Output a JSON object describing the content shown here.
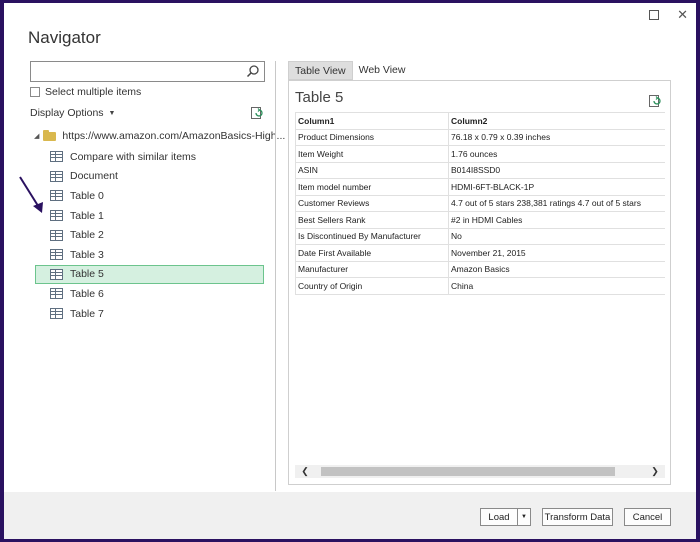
{
  "window": {
    "title": "Navigator",
    "accent_color": "#2a1160"
  },
  "left": {
    "search": {
      "value": "",
      "placeholder": ""
    },
    "select_multiple_label": "Select multiple items",
    "display_options_label": "Display Options",
    "tree_root_label": "https://www.amazon.com/AmazonBasics-High...",
    "items": [
      {
        "label": "Compare with similar items"
      },
      {
        "label": "Document"
      },
      {
        "label": "Table 0"
      },
      {
        "label": "Table 1"
      },
      {
        "label": "Table 2"
      },
      {
        "label": "Table 3"
      },
      {
        "label": "Table 5",
        "selected": true
      },
      {
        "label": "Table 6"
      },
      {
        "label": "Table 7"
      }
    ]
  },
  "right": {
    "tabs": [
      {
        "label": "Table View"
      },
      {
        "label": "Web View"
      }
    ],
    "preview_title": "Table 5",
    "columns": [
      "Column1",
      "Column2"
    ],
    "rows": [
      [
        "Product Dimensions",
        "76.18 x 0.79 x 0.39 inches"
      ],
      [
        "Item Weight",
        "1.76 ounces"
      ],
      [
        "ASIN",
        "B014I8SSD0"
      ],
      [
        "Item model number",
        "HDMI-6FT-BLACK-1P"
      ],
      [
        "Customer Reviews",
        "4.7 out of 5 stars 238,381 ratings 4.7 out of 5 stars"
      ],
      [
        "Best Sellers Rank",
        "#2 in HDMI Cables"
      ],
      [
        "Is Discontinued By Manufacturer",
        "No"
      ],
      [
        "Date First Available",
        "November 21, 2015"
      ],
      [
        "Manufacturer",
        "Amazon Basics"
      ],
      [
        "Country of Origin",
        "China"
      ]
    ]
  },
  "footer": {
    "load_label": "Load",
    "transform_label": "Transform Data",
    "cancel_label": "Cancel"
  },
  "colors": {
    "selected_bg": "#d5f0e0",
    "selected_border": "#6cc48d"
  }
}
